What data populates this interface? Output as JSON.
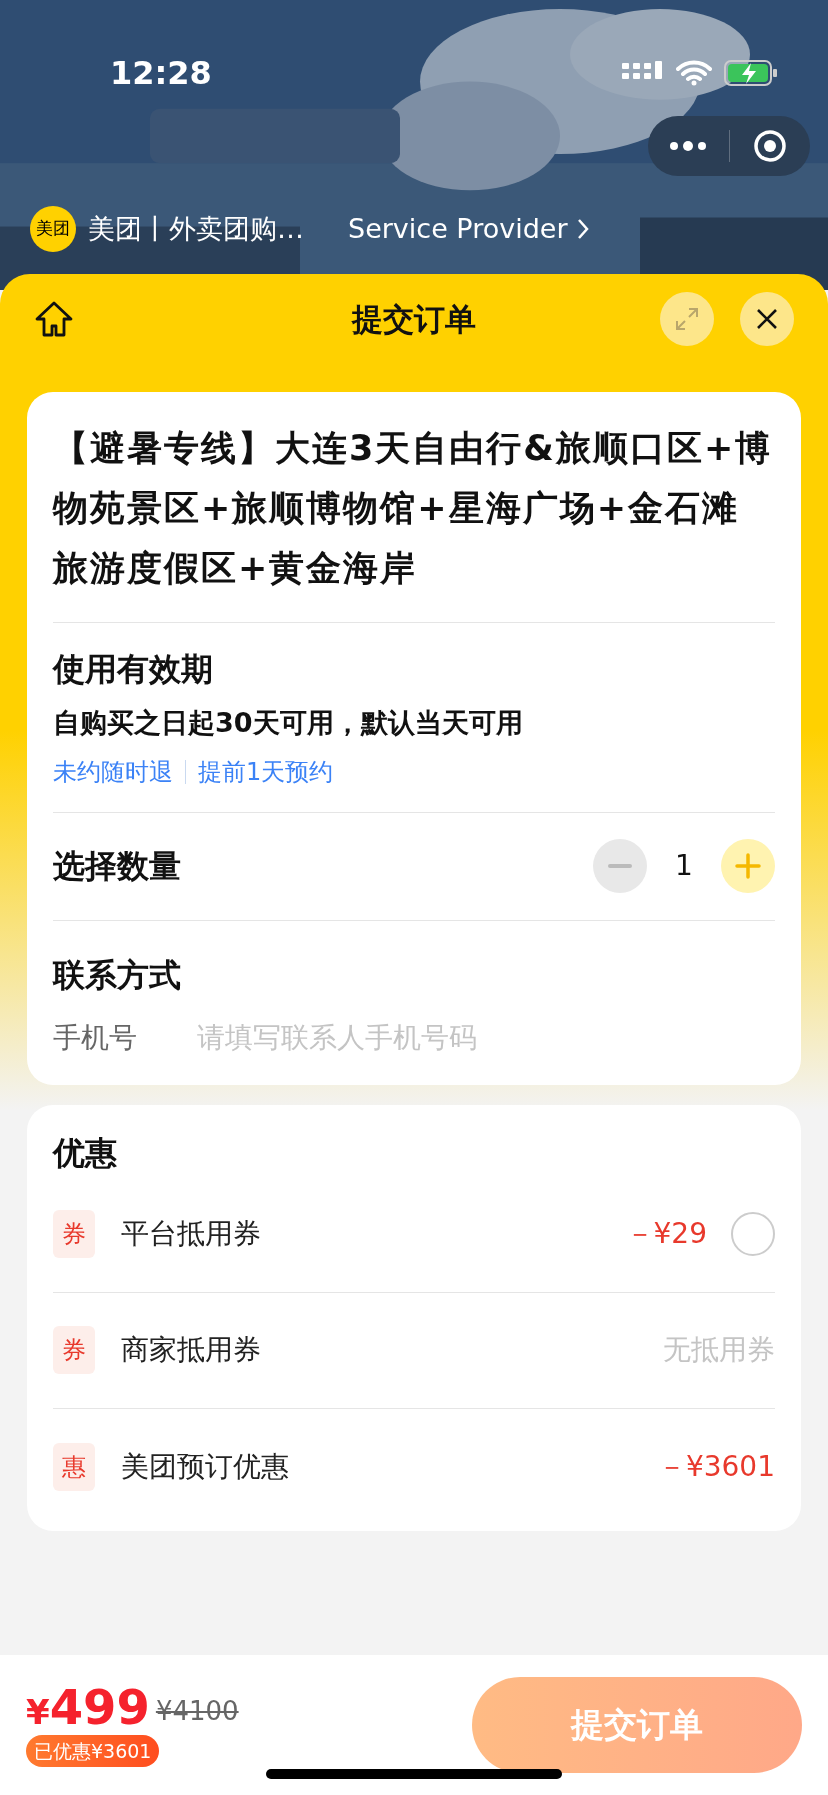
{
  "status_bar": {
    "time": "12:28"
  },
  "mini_program": {
    "logo": "美团",
    "name": "美团丨外卖团购…",
    "provider": "Service Provider"
  },
  "header": {
    "title": "提交订单"
  },
  "product": {
    "title": "【避暑专线】大连3天自由行&旅顺口区+博物苑景区+旅顺博物馆+星海广场+金石滩旅游度假区+黄金海岸"
  },
  "validity": {
    "label": "使用有效期",
    "text": "自购买之日起30天可用，默认当天可用",
    "tags": [
      "未约随时退",
      "提前1天预约"
    ]
  },
  "quantity": {
    "label": "选择数量",
    "value": "1",
    "minus_disabled": true
  },
  "contact": {
    "label": "联系方式",
    "field_label": "手机号",
    "placeholder": "请填写联系人手机号码"
  },
  "discounts": {
    "title": "优惠",
    "items": [
      {
        "tag": "券",
        "label": "平台抵用券",
        "value": "－¥29",
        "kind": "discount",
        "checked": false
      },
      {
        "tag": "券",
        "label": "商家抵用券",
        "value": "无抵用券",
        "kind": "none"
      },
      {
        "tag": "惠",
        "label": "美团预订优惠",
        "value": "－¥3601",
        "kind": "discount"
      }
    ]
  },
  "footer": {
    "price_symbol": "¥",
    "price": "499",
    "original_price": "¥4100",
    "saved": "已优惠¥3601",
    "submit": "提交订单"
  }
}
